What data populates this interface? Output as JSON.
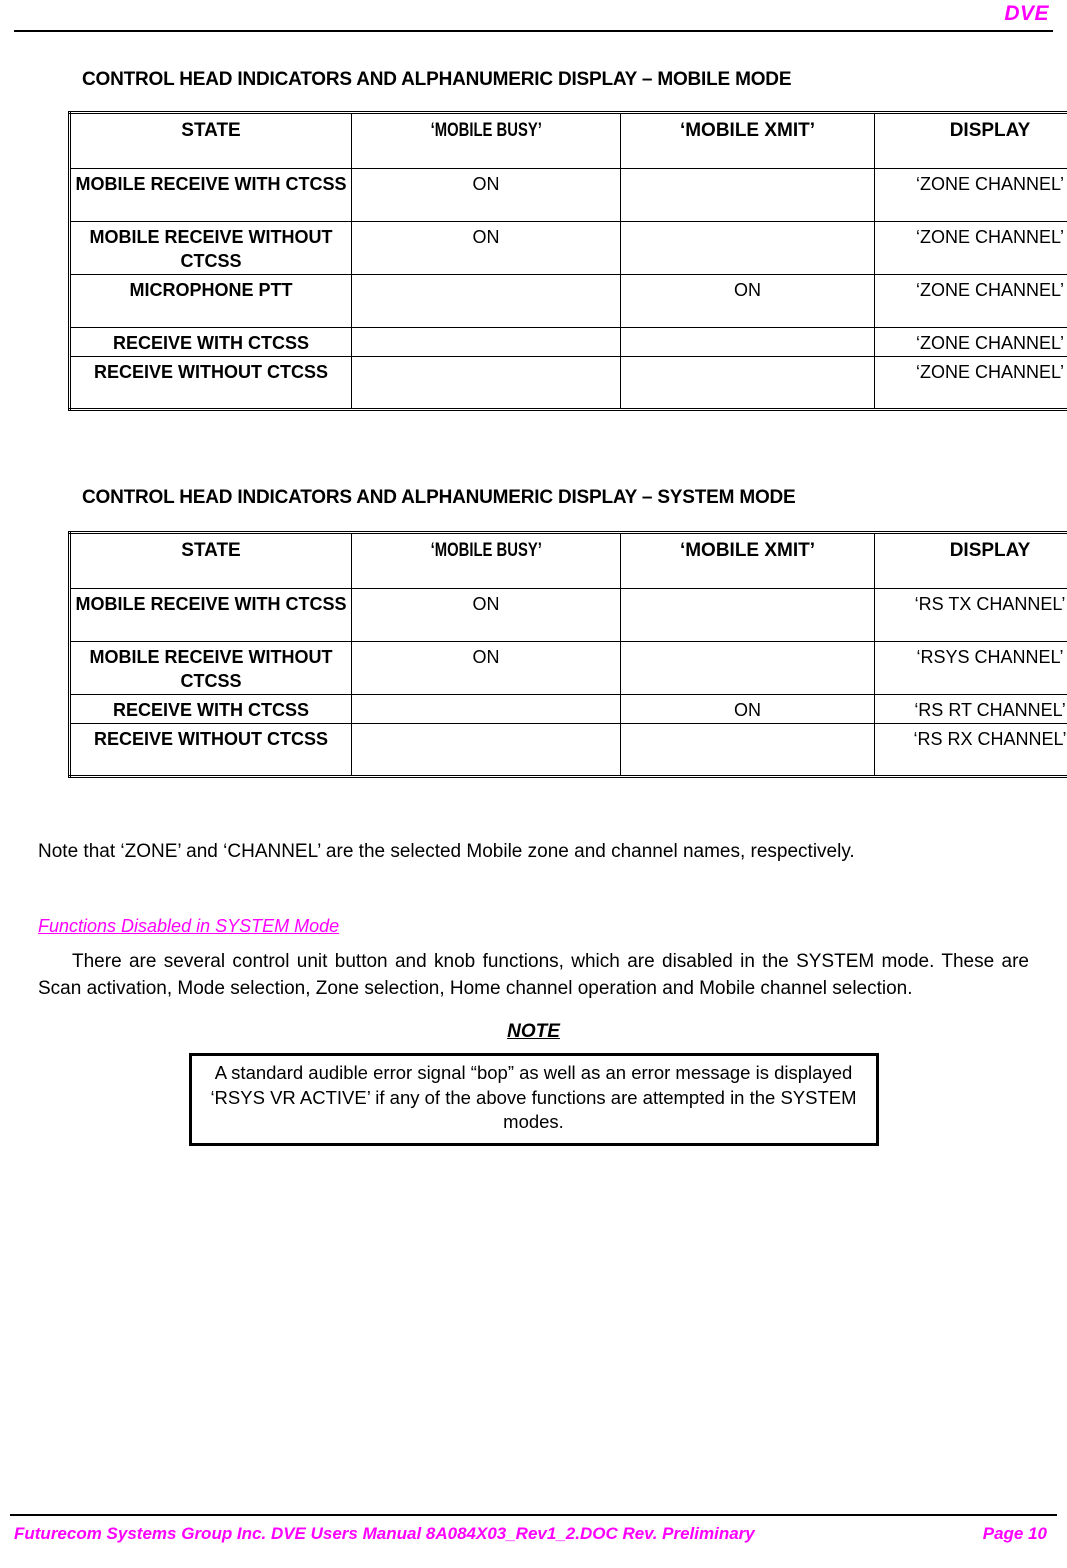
{
  "header": {
    "right_text": "DVE"
  },
  "sections": [
    {
      "title": "CONTROL HEAD INDICATORS AND ALPHANUMERIC DISPLAY – MOBILE MODE",
      "table": {
        "columns": [
          "STATE",
          "‘MOBILE BUSY’",
          "‘MOBILE XMIT’",
          "DISPLAY"
        ],
        "rows": [
          {
            "state": "MOBILE RECEIVE WITH CTCSS",
            "busy": "ON",
            "xmit": "",
            "display": "‘ZONE CHANNEL’"
          },
          {
            "state": "MOBILE RECEIVE WITHOUT CTCSS",
            "busy": "ON",
            "xmit": "",
            "display": "‘ZONE CHANNEL’"
          },
          {
            "state": "MICROPHONE PTT",
            "busy": "",
            "xmit": "ON",
            "display": "‘ZONE CHANNEL’"
          },
          {
            "state": "RECEIVE WITH CTCSS",
            "busy": "",
            "xmit": "",
            "display": "‘ZONE CHANNEL’"
          },
          {
            "state": "RECEIVE WITHOUT CTCSS",
            "busy": "",
            "xmit": "",
            "display": "‘ZONE CHANNEL’"
          }
        ]
      }
    },
    {
      "title": "CONTROL HEAD INDICATORS AND ALPHANUMERIC DISPLAY – SYSTEM MODE",
      "table": {
        "columns": [
          "STATE",
          "‘MOBILE BUSY’",
          "‘MOBILE XMIT’",
          "DISPLAY"
        ],
        "rows": [
          {
            "state": "MOBILE RECEIVE WITH CTCSS",
            "busy": "ON",
            "xmit": "",
            "display": "‘RS TX CHANNEL’"
          },
          {
            "state": "MOBILE RECEIVE WITHOUT CTCSS",
            "busy": "ON",
            "xmit": "",
            "display": "‘RSYS CHANNEL’"
          },
          {
            "state": "RECEIVE WITH CTCSS",
            "busy": "",
            "xmit": "ON",
            "display": "‘RS RT CHANNEL’"
          },
          {
            "state": "RECEIVE WITHOUT CTCSS",
            "busy": "",
            "xmit": "",
            "display": "‘RS RX CHANNEL’"
          }
        ]
      }
    }
  ],
  "body": {
    "zone_note": "Note that ‘ZONE’ and ‘CHANNEL’ are the selected Mobile zone and channel names, respectively.",
    "subheading": "Functions Disabled in SYSTEM Mode",
    "paragraph": "There are several control unit button and knob functions, which are disabled in the SYSTEM mode. These are Scan activation, Mode selection, Zone selection, Home channel operation and Mobile channel selection.",
    "note_heading": "NOTE",
    "note_box": "A standard audible error signal “bop” as well as an error message is displayed ‘RSYS VR ACTIVE’ if any of the above functions are attempted in the SYSTEM modes."
  },
  "footer": {
    "left": "Futurecom Systems Group Inc.  DVE Users Manual 8A084X03_Rev1_2.DOC Rev. Preliminary",
    "right": "Page 10"
  },
  "colors": {
    "accent": "#FF00FF",
    "text": "#000000",
    "background": "#FFFFFF"
  }
}
